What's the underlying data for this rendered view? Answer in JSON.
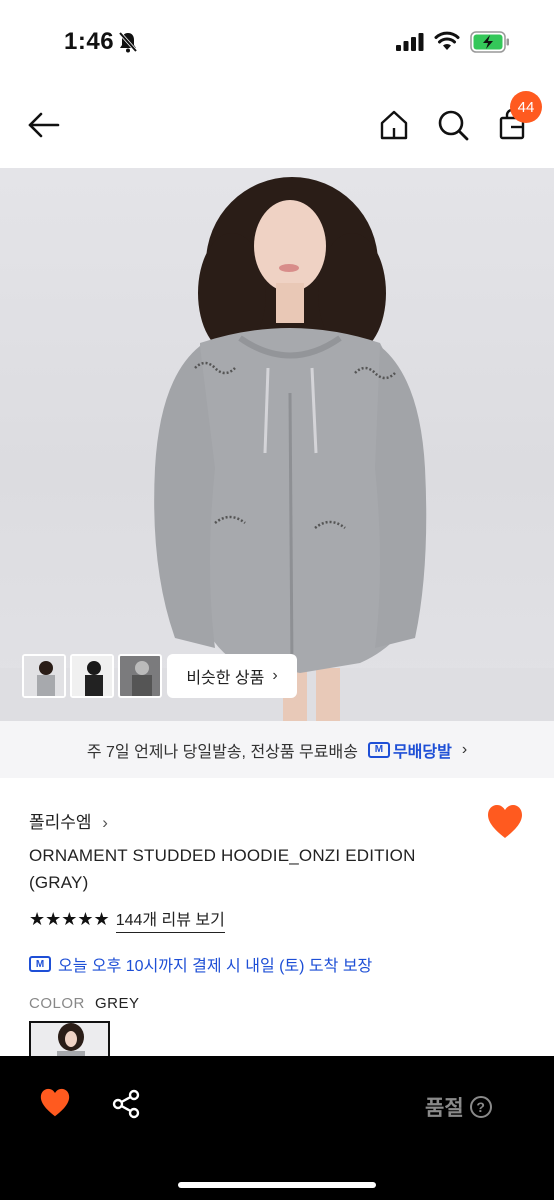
{
  "status_bar": {
    "time": "1:46"
  },
  "nav": {
    "cart_count": "44"
  },
  "hero": {
    "similar_button_label": "비슷한 상품",
    "similar_button_chevron": "›"
  },
  "delivery_banner": {
    "text": "주 7일 언제나 당일발송, 전상품 무료배송",
    "badge_letter": "M",
    "badge_label": "무배당발",
    "chevron": "›"
  },
  "product": {
    "brand": "폴리수엠",
    "brand_chevron": "›",
    "title": "ORNAMENT STUDDED HOODIE_ONZI EDITION (GRAY)",
    "rating_stars": 5,
    "stars_text": "★★★★★",
    "review_link": "144개 리뷰 보기",
    "arrival_badge_letter": "M",
    "arrival_text": "오늘 오후 10시까지 결제 시 내일 (토) 도착 보장",
    "color_label": "COLOR",
    "color_value": "GREY",
    "favorited": true
  },
  "bottom_bar": {
    "status_label": "품절",
    "help_symbol": "?"
  },
  "colors": {
    "accent_orange": "#ff5a1f",
    "link_blue": "#1e4fd6",
    "bottom_bar_bg": "#000000",
    "soldout_gray": "#8a8a8a"
  },
  "icons": [
    "bell-off-icon",
    "signal-icon",
    "wifi-icon",
    "battery-icon",
    "back-arrow-icon",
    "home-icon",
    "search-icon",
    "shopping-bag-icon",
    "heart-icon",
    "share-icon",
    "help-icon",
    "delivery-truck-icon"
  ]
}
